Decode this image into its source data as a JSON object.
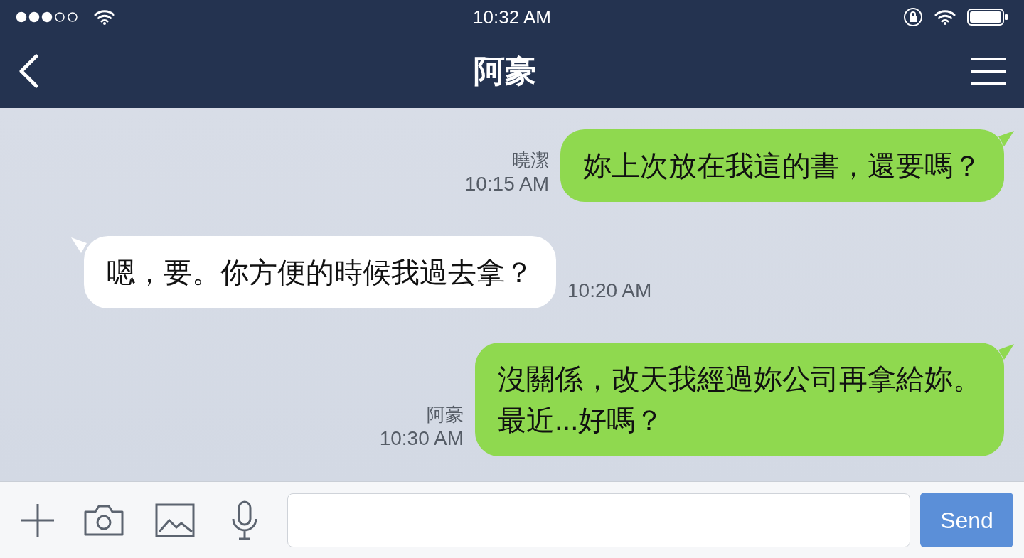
{
  "status_bar": {
    "time": "10:32 AM"
  },
  "header": {
    "title": "阿豪"
  },
  "messages": [
    {
      "kind": "sent",
      "sender": "曉潔",
      "time": "10:15 AM",
      "lines": [
        "妳上次放在我這的書，還要嗎？"
      ]
    },
    {
      "kind": "received",
      "time": "10:20 AM",
      "lines": [
        "嗯，要。你方便的時候我過去拿？"
      ]
    },
    {
      "kind": "sent",
      "sender": "阿豪",
      "time": "10:30 AM",
      "lines": [
        "沒關係，改天我經過妳公司再拿給妳。",
        "最近...好嗎？"
      ]
    }
  ],
  "composer": {
    "send_label": "Send"
  }
}
